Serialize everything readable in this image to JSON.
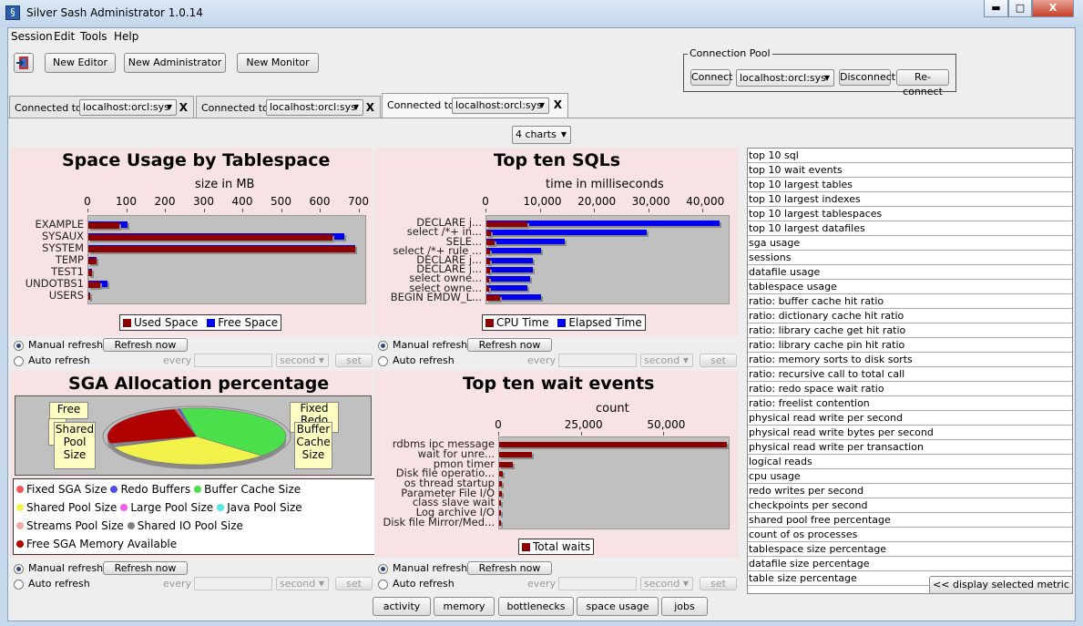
{
  "window": {
    "title": "Silver Sash Administrator 1.0.14",
    "min": "▬",
    "max": "□",
    "close": "X"
  },
  "menu": [
    "Session",
    "Edit",
    "Tools",
    "Help"
  ],
  "toolbar": {
    "new_editor": "New Editor",
    "new_administrator": "New Administrator",
    "new_monitor": "New Monitor"
  },
  "connection_pool": {
    "label": "Connection Pool",
    "connect": "Connect",
    "selected": "localhost:orcl:sys",
    "disconnect": "Disconnect",
    "reconnect": "Re-connect"
  },
  "tabs": [
    {
      "prefix": "Connected to:",
      "connection": "localhost:orcl:sys",
      "close": "X"
    },
    {
      "prefix": "Connected to:",
      "connection": "localhost:orcl:sys",
      "close": "X"
    },
    {
      "prefix": "Connected to:",
      "connection": "localhost:orcl:sys",
      "close": "X"
    }
  ],
  "layout_select": "4 charts",
  "refresh": {
    "manual": "Manual refresh",
    "auto": "Auto refresh",
    "now": "Refresh now",
    "every": "every",
    "unit": "second",
    "set": "set"
  },
  "chart_data": [
    {
      "type": "bar",
      "orientation": "horizontal",
      "title": "Space Usage by Tablespace",
      "xlabel": "size in MB",
      "xlim": [
        0,
        720
      ],
      "ticks": [
        "0",
        "100",
        "200",
        "300",
        "400",
        "500",
        "600",
        "700"
      ],
      "categories": [
        "EXAMPLE",
        "SYSAUX",
        "SYSTEM",
        "TEMP",
        "TEST1",
        "UNDOTBS1",
        "USERS"
      ],
      "series": [
        {
          "name": "Used Space",
          "color": "#8b0000",
          "values": [
            80,
            630,
            690,
            20,
            10,
            30,
            5
          ]
        },
        {
          "name": "Free Space",
          "color": "#0000ee",
          "values": [
            100,
            660,
            690,
            20,
            10,
            50,
            5
          ]
        }
      ]
    },
    {
      "type": "bar",
      "orientation": "horizontal",
      "title": "Top ten SQLs",
      "xlabel": "time in milliseconds",
      "xlim": [
        0,
        45000
      ],
      "ticks": [
        "0",
        "10,000",
        "20,000",
        "30,000",
        "40,000"
      ],
      "categories": [
        "DECLARE j...",
        "select /*+ in...",
        "SELE...",
        "select /*+ rule ...",
        "DECLARE j...",
        "DECLARE j...",
        "select owne...",
        "select owne...",
        "BEGIN EMDW_L..."
      ],
      "series": [
        {
          "name": "CPU Time",
          "color": "#8b0000",
          "values": [
            7500,
            900,
            1500,
            700,
            600,
            600,
            500,
            500,
            2500
          ]
        },
        {
          "name": "Elapsed Time",
          "color": "#0000ee",
          "values": [
            43000,
            29500,
            14500,
            10000,
            8500,
            8500,
            8000,
            7500,
            10000
          ]
        }
      ]
    },
    {
      "type": "pie",
      "title": "SGA Allocation percentage",
      "slices": [
        {
          "name": "Fixed SGA Size",
          "value": 0.5,
          "color": "#f25555"
        },
        {
          "name": "Redo Buffers",
          "value": 0.5,
          "color": "#5050f0"
        },
        {
          "name": "Buffer Cache Size",
          "value": 40,
          "color": "#4be04b"
        },
        {
          "name": "Shared Pool Size",
          "value": 32,
          "color": "#f2f24a"
        },
        {
          "name": "Large Pool Size",
          "value": 0.5,
          "color": "#f060f0"
        },
        {
          "name": "Java Pool Size",
          "value": 0.5,
          "color": "#50e8e8"
        },
        {
          "name": "Streams Pool Size",
          "value": 0.5,
          "color": "#f3a6a6"
        },
        {
          "name": "Shared IO Pool Size",
          "value": 0.5,
          "color": "#808080"
        },
        {
          "name": "Free SGA Memory Available",
          "value": 25,
          "color": "#b00000"
        }
      ],
      "notes": [
        [
          "Free"
        ],
        [
          "Fixed",
          "Redo",
          "Buffer"
        ],
        [
          "Shared",
          "Pool",
          "Size"
        ],
        [
          "Buffer",
          "Cache",
          "Size"
        ]
      ]
    },
    {
      "type": "bar",
      "orientation": "horizontal",
      "title": "Top ten wait events",
      "xlabel": "count",
      "xlim": [
        0,
        70000
      ],
      "ticks": [
        "0",
        "25,000",
        "50,000"
      ],
      "categories": [
        "rdbms ipc message",
        "wait for unre...",
        "pmon timer",
        "Disk file operatio...",
        "os thread startup",
        "Parameter File I/O",
        "class slave wait",
        "Log archive I/O",
        "Disk file Mirror/Med..."
      ],
      "series": [
        {
          "name": "Total waits",
          "color": "#8b0000",
          "values": [
            69000,
            10000,
            4000,
            1200,
            800,
            700,
            600,
            500,
            500
          ]
        }
      ]
    }
  ],
  "metrics": [
    "top 10 sql",
    "top 10 wait events",
    "top 10 largest tables",
    "top 10 largest indexes",
    "top 10 largest tablespaces",
    "top 10 largest datafiles",
    "sga usage",
    "sessions",
    "datafile usage",
    "tablespace usage",
    "ratio: buffer cache hit ratio",
    "ratio: dictionary cache hit ratio",
    "ratio: library cache get hit ratio",
    "ratio: library cache pin hit ratio",
    "ratio: memory sorts to disk sorts",
    "ratio: recursive call to total call",
    "ratio: redo space wait ratio",
    "ratio: freelist contention",
    "physical read write per second",
    "physical read write bytes per second",
    "physical read write per transaction",
    "logical reads",
    "cpu usage",
    "redo writes per second",
    "checkpoints per second",
    "shared pool free percentage",
    "count of os processes",
    "tablespace size percentage",
    "datafile size percentage",
    "table size percentage"
  ],
  "display_metric_button": "<< display selected metric",
  "bottom_tabs": [
    "activity",
    "memory",
    "bottlenecks",
    "space usage",
    "jobs"
  ]
}
